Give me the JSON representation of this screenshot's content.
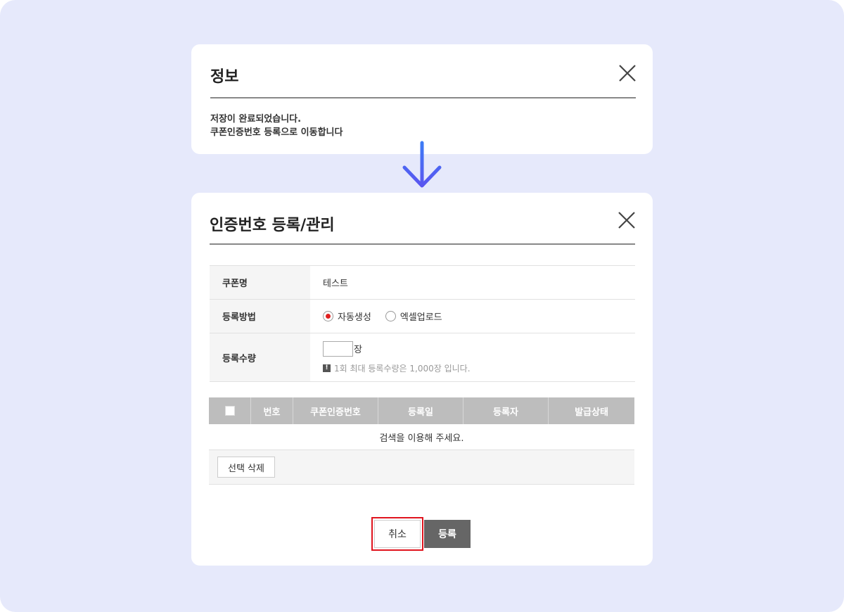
{
  "info_dialog": {
    "title": "정보",
    "message_line1": "저장이 완료되었습니다.",
    "message_line2": "쿠폰인증번호 등록으로 이동합니다"
  },
  "register_dialog": {
    "title": "인증번호 등록/관리",
    "form": {
      "coupon_name_label": "쿠폰명",
      "coupon_name_value": "테스트",
      "method_label": "등록방법",
      "method_options": [
        {
          "label": "자동생성",
          "selected": true
        },
        {
          "label": "엑셀업로드",
          "selected": false
        }
      ],
      "quantity_label": "등록수량",
      "quantity_value": "",
      "quantity_unit": "장",
      "notice": "1회 최대 등록수량은 1,000장 입니다."
    },
    "list": {
      "columns": [
        "번호",
        "쿠폰인증번호",
        "등록일",
        "등록자",
        "발급상태"
      ],
      "empty_message": "검색을 이용해 주세요."
    },
    "delete_selected_label": "선택 삭제",
    "cancel_label": "취소",
    "submit_label": "등록"
  },
  "colors": {
    "background": "#e6e9fb",
    "highlight": "#e0141e",
    "arrow": "#4a63f0",
    "radio_selected": "#e02020"
  },
  "icons": {
    "close": "close-icon",
    "arrow": "arrow-down-icon",
    "notice": "exclamation-icon"
  }
}
